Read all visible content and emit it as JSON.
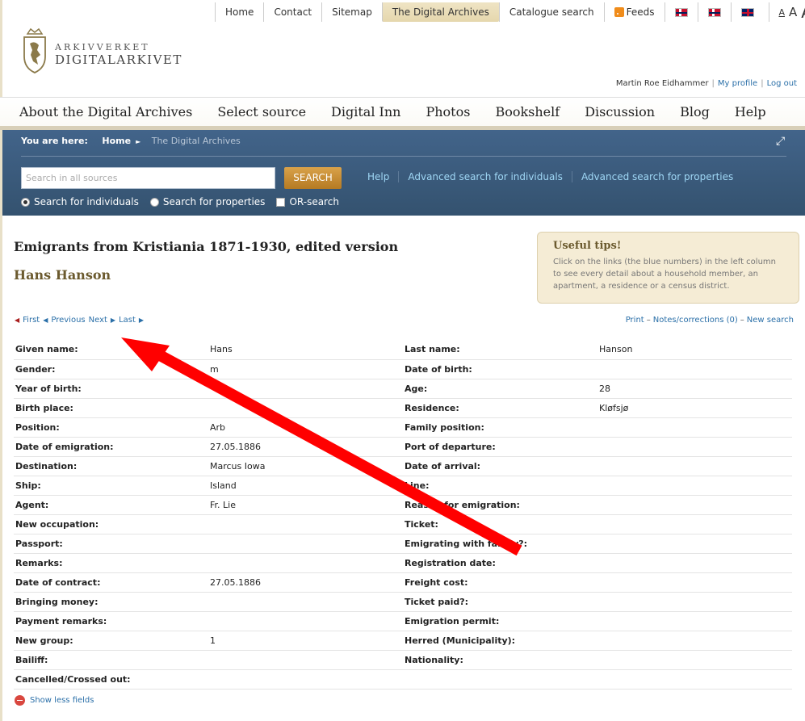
{
  "topnav": {
    "items": [
      "Home",
      "Contact",
      "Sitemap",
      "The Digital Archives",
      "Catalogue search"
    ],
    "feeds": "Feeds",
    "font_sizes": [
      "A",
      "A",
      "A"
    ]
  },
  "logo": {
    "line1": "ARKIVVERKET",
    "line2": "DIGITALARKIVET"
  },
  "user": {
    "name": "Martin Roe Eidhammer",
    "profile": "My profile",
    "logout": "Log out"
  },
  "mainnav": [
    "About the Digital Archives",
    "Select source",
    "Digital Inn",
    "Photos",
    "Bookshelf",
    "Discussion",
    "Blog",
    "Help"
  ],
  "panel": {
    "you_are_here": "You are here:",
    "home": "Home",
    "current": "The Digital Archives",
    "search_placeholder": "Search in all sources",
    "search_button": "SEARCH",
    "links": [
      "Help",
      "Advanced search for individuals",
      "Advanced search for properties"
    ],
    "opt_individuals": "Search for individuals",
    "opt_properties": "Search for properties",
    "opt_or": "OR-search"
  },
  "record": {
    "title": "Emigrants from Kristiania 1871-1930, edited version",
    "person": "Hans Hanson"
  },
  "tips": {
    "heading": "Useful tips!",
    "body": "Click on the links (the blue numbers) in the left column to see every detail about a household member, an apartment, a residence or a census district."
  },
  "pager": {
    "first": "First",
    "previous": "Previous",
    "next": "Next",
    "last": "Last"
  },
  "actions": {
    "print": "Print",
    "notes": "Notes/corrections (0)",
    "new_search": "New search"
  },
  "rows": [
    [
      "Given name:",
      "Hans",
      "Last name:",
      "Hanson"
    ],
    [
      "Gender:",
      "m",
      "Date of birth:",
      ""
    ],
    [
      "Year of birth:",
      "",
      "Age:",
      "28"
    ],
    [
      "Birth place:",
      "",
      "Residence:",
      "Kløfsjø"
    ],
    [
      "Position:",
      "Arb",
      "Family position:",
      ""
    ],
    [
      "Date of emigration:",
      "27.05.1886",
      "Port of departure:",
      ""
    ],
    [
      "Destination:",
      "Marcus Iowa",
      "Date of arrival:",
      ""
    ],
    [
      "Ship:",
      "Island",
      "Line:",
      ""
    ],
    [
      "Agent:",
      "Fr. Lie",
      "Reason for emigration:",
      ""
    ],
    [
      "New occupation:",
      "",
      "Ticket:",
      ""
    ],
    [
      "Passport:",
      "",
      "Emigrating with family?:",
      ""
    ],
    [
      "Remarks:",
      "",
      "Registration date:",
      ""
    ],
    [
      "Date of contract:",
      "27.05.1886",
      "Freight cost:",
      ""
    ],
    [
      "Bringing money:",
      "",
      "Ticket paid?:",
      ""
    ],
    [
      "Payment remarks:",
      "",
      "Emigration permit:",
      ""
    ],
    [
      "New group:",
      "1",
      "Herred (Municipality):",
      ""
    ],
    [
      "Bailiff:",
      "",
      "Nationality:",
      ""
    ],
    [
      "Cancelled/Crossed out:",
      "",
      "",
      ""
    ]
  ],
  "show_less": "Show less fields",
  "colors": {
    "panel": "#3b5a7c",
    "accent_gold": "#6b5a2e",
    "link": "#2a6fa8",
    "arrow": "#ff0000"
  }
}
